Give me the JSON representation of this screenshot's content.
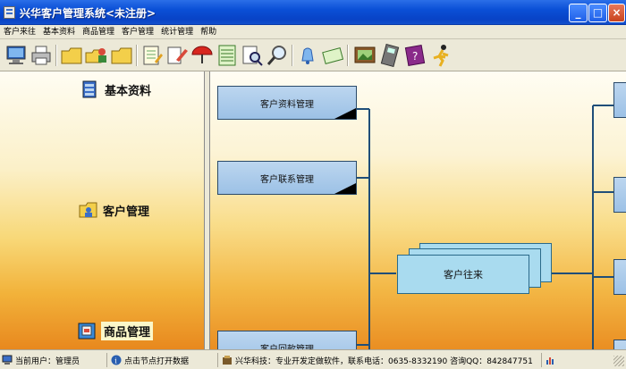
{
  "window": {
    "title": "兴华客户管理系统<未注册>",
    "minimize_glyph": "_",
    "maximize_glyph": "□",
    "close_glyph": "×"
  },
  "menu": [
    "客户来往",
    "基本资料",
    "商品管理",
    "客户管理",
    "统计管理",
    "帮助"
  ],
  "toolbar": {
    "icons": [
      "monitor-icon",
      "printer-icon",
      "folder-icon",
      "user-folders-icon",
      "folder-icon",
      "notepad-icon",
      "document-edit-icon",
      "umbrella-icon",
      "spreadsheet-icon",
      "find-document-icon",
      "magnifier-icon",
      "bell-icon",
      "envelope-icon",
      "picture-icon",
      "calculator-icon",
      "help-book-icon",
      "runner-icon"
    ]
  },
  "sidebar": {
    "items": [
      {
        "label": "基本资料",
        "icon": "database-icon",
        "active": false
      },
      {
        "label": "客户管理",
        "icon": "contacts-folder-icon",
        "active": false
      },
      {
        "label": "商品管理",
        "icon": "product-box-icon",
        "active": true
      }
    ]
  },
  "diagram": {
    "nodes": [
      {
        "label": "客户资料管理"
      },
      {
        "label": "客户联系管理"
      },
      {
        "label": "客户回款管理"
      }
    ],
    "main_node": "客户往来"
  },
  "status": {
    "user": "当前用户：管理员",
    "hint": "点击节点打开数据",
    "company": "兴华科技：专业开发定做软件，联系电话：0635-8332190 咨询QQ：842847751"
  },
  "colors": {
    "title_bar": "#0a4fd6",
    "node_fill": "#9cc1e6",
    "main_node_fill": "#a9dbef",
    "connector": "#1f4e79",
    "background_top": "#fffdf3",
    "background_bottom": "#ea8e22"
  }
}
